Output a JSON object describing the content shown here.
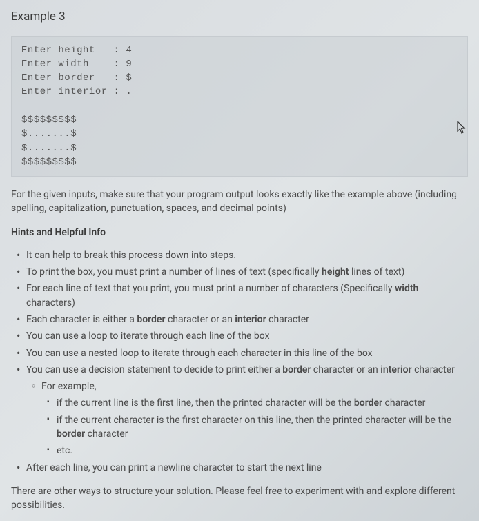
{
  "title": "Example 3",
  "code_block": "Enter height   : 4\nEnter width    : 9\nEnter border   : $\nEnter interior : .\n\n$$$$$$$$$\n$.......$\n$.......$\n$$$$$$$$$",
  "instruction": "For the given inputs, make sure that your program output looks exactly like the example above (including spelling, capitalization, punctuation, spaces, and decimal points)",
  "hints_heading": "Hints and Helpful Info",
  "hints": {
    "h1": "It can help to break this process down into steps.",
    "h2a": "To print the box, you must print a number of lines of text (specifically ",
    "h2b": "height",
    "h2c": " lines of text)",
    "h3a": "For each line of text that you print, you must print a number of characters (Specifically ",
    "h3b": "width",
    "h3c": " characters)",
    "h4a": "Each character is either a ",
    "h4b": "border",
    "h4c": " character or an ",
    "h4d": "interior",
    "h4e": " character",
    "h5": "You can use a loop to iterate through each line of the box",
    "h6": "You can use a nested loop to iterate through each character in this line of the box",
    "h7a": "You can use a decision statement to decide to print either a ",
    "h7b": "border",
    "h7c": " character or an ",
    "h7d": "interior",
    "h7e": " character",
    "sub_for_example": "For example,",
    "s1a": "if the current line is the first line, then the printed character will be the ",
    "s1b": "border",
    "s1c": " character",
    "s2a": "if the current character is the first character on this line, then the printed character will be the ",
    "s2b": "border",
    "s2c": " character",
    "s3": "etc.",
    "h8": "After each line, you can print a newline character to start the next line"
  },
  "closing": "There are other ways to structure your solution. Please feel free to experiment with and explore different possibilities."
}
